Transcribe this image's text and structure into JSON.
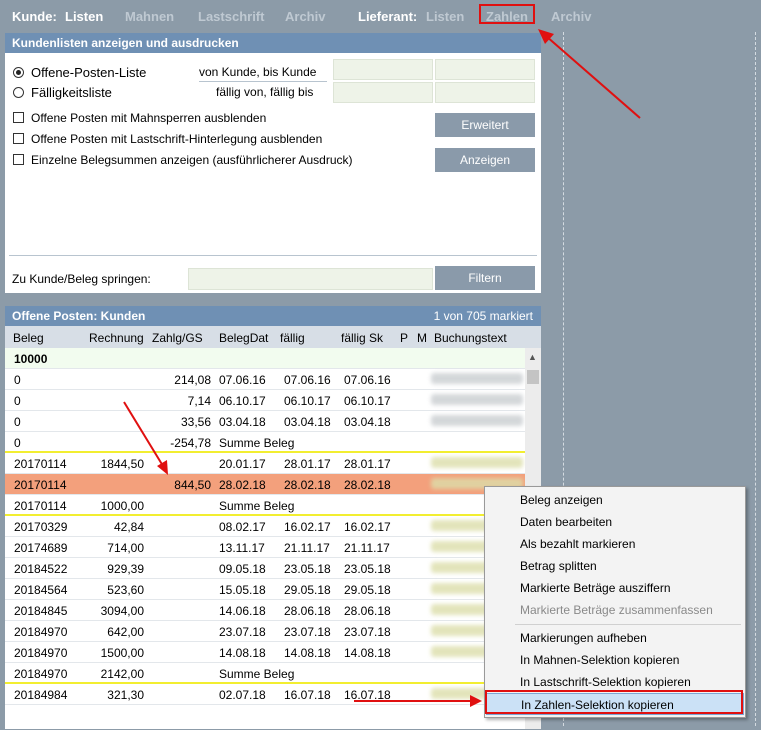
{
  "nav": {
    "kunde_label": "Kunde:",
    "kunde_items": [
      "Listen",
      "Mahnen",
      "Lastschrift",
      "Archiv"
    ],
    "lieferant_label": "Lieferant:",
    "lieferant_items": [
      "Listen",
      "Zahlen",
      "Archiv"
    ]
  },
  "panel1": {
    "title": "Kundenlisten anzeigen und ausdrucken",
    "radio1": {
      "label": "Offene-Posten-Liste",
      "range": "von Kunde, bis Kunde",
      "selected": true
    },
    "radio2": {
      "label": "Fälligkeitsliste",
      "range": "fällig von, fällig bis",
      "selected": false
    },
    "checkboxes": [
      "Offene Posten mit Mahnsperren ausblenden",
      "Offene Posten mit Lastschrift-Hinterlegung ausblenden",
      "Einzelne Belegsummen anzeigen (ausführlicherer Ausdruck)"
    ],
    "btn_erweitert": "Erweitert",
    "btn_anzeigen": "Anzeigen",
    "jump_label": "Zu Kunde/Beleg springen:",
    "btn_filtern": "Filtern"
  },
  "panel2": {
    "title": "Offene Posten: Kunden",
    "count": "1 von 705 markiert",
    "columns": [
      "Beleg",
      "Rechnung",
      "Zahlg/GS",
      "BelegDat",
      "fällig",
      "fällig Sk",
      "P",
      "M",
      "Buchungstext"
    ],
    "group": "10000",
    "rows": [
      [
        "0",
        "",
        "214,08",
        "07.06.16",
        "07.06.16",
        "07.06.16"
      ],
      [
        "0",
        "",
        "7,14",
        "06.10.17",
        "06.10.17",
        "06.10.17"
      ],
      [
        "0",
        "",
        "33,56",
        "03.04.18",
        "03.04.18",
        "03.04.18"
      ],
      [
        "0",
        "",
        "-254,78",
        "Summe Beleg",
        "",
        ""
      ],
      [
        "20170114",
        "1844,50",
        "",
        "20.01.17",
        "28.01.17",
        "28.01.17"
      ],
      [
        "20170114",
        "",
        "844,50",
        "28.02.18",
        "28.02.18",
        "28.02.18"
      ],
      [
        "20170114",
        "1000,00",
        "",
        "Summe Beleg",
        "",
        ""
      ],
      [
        "20170329",
        "42,84",
        "",
        "08.02.17",
        "16.02.17",
        "16.02.17"
      ],
      [
        "20174689",
        "714,00",
        "",
        "13.11.17",
        "21.11.17",
        "21.11.17"
      ],
      [
        "20184522",
        "929,39",
        "",
        "09.05.18",
        "23.05.18",
        "23.05.18"
      ],
      [
        "20184564",
        "523,60",
        "",
        "15.05.18",
        "29.05.18",
        "29.05.18"
      ],
      [
        "20184845",
        "3094,00",
        "",
        "14.06.18",
        "28.06.18",
        "28.06.18"
      ],
      [
        "20184970",
        "642,00",
        "",
        "23.07.18",
        "23.07.18",
        "23.07.18"
      ],
      [
        "20184970",
        "1500,00",
        "",
        "14.08.18",
        "14.08.18",
        "14.08.18"
      ],
      [
        "20184970",
        "2142,00",
        "",
        "Summe Beleg",
        "",
        ""
      ],
      [
        "20184984",
        "321,30",
        "",
        "02.07.18",
        "16.07.18",
        "16.07.18"
      ]
    ]
  },
  "context_menu": {
    "items": [
      "Beleg anzeigen",
      "Daten bearbeiten",
      "Als bezahlt markieren",
      "Betrag splitten",
      "Markierte Beträge ausziffern",
      "Markierte Beträge zusammenfassen",
      "Markierungen aufheben",
      "In Mahnen-Selektion kopieren",
      "In Lastschrift-Selektion kopieren",
      "In Zahlen-Selektion kopieren"
    ]
  },
  "colors": {
    "highlight_row": "#f3a07c",
    "header_blue": "#6f90b4",
    "annotation_red": "#e01010"
  }
}
